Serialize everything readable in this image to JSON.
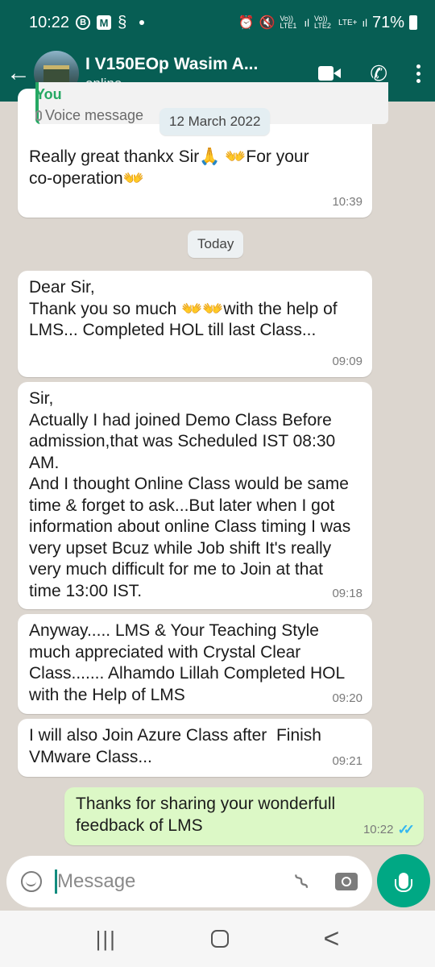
{
  "status_bar": {
    "time": "10:22",
    "icons": [
      "b-circle-icon",
      "m-square-icon",
      "swiggy-icon",
      "dot-icon"
    ],
    "network_labels": [
      "Vo)) LTE1",
      "Vo)) LTE2",
      "LTE+"
    ],
    "battery_percent": "71%"
  },
  "header": {
    "back_label": "←",
    "chat_name": "I V150EOp Wasim A...",
    "chat_status": "online",
    "actions": [
      "video-call-icon",
      "voice-call-icon",
      "more-options-icon"
    ]
  },
  "chat": {
    "date_pill": "12 March 2022",
    "today_pill": "Today",
    "quote": {
      "author": "You",
      "text": "Voice message"
    },
    "messages": [
      {
        "direction": "in",
        "text": "Really great thankx Sir🙏 👐For your co-operation👐",
        "time": "10:39"
      },
      {
        "direction": "in",
        "text": "Dear Sir,\nThank you so much 👐👐with the help of LMS... Completed HOL till last Class...",
        "time": "09:09"
      },
      {
        "direction": "in",
        "text": "Sir,\nActually I had joined Demo Class Before admission,that was Scheduled IST 08:30 AM.\nAnd I thought Online Class would be same time & forget to ask...But later when I got information about online Class timing I was very upset Bcuz while Job shift It's really very much difficult for me to Join at that time 13:00 IST.",
        "time": "09:18"
      },
      {
        "direction": "in",
        "text": "Anyway..... LMS & Your Teaching Style much appreciated with Crystal Clear Class....... Alhamdo Lillah Completed HOL with the Help of LMS",
        "time": "09:20"
      },
      {
        "direction": "in",
        "text": "I will also Join Azure Class after  Finish VMware Class...",
        "time": "09:21"
      },
      {
        "direction": "out",
        "text": "Thanks for sharing your wonderfull feedback of LMS",
        "time": "10:22",
        "ticks": "✓✓"
      }
    ]
  },
  "composer": {
    "placeholder": "Message",
    "icons": [
      "emoji-icon",
      "attach-icon",
      "camera-icon",
      "mic-icon"
    ]
  },
  "navbar": {
    "recent": "|||",
    "back": "<"
  },
  "colors": {
    "header": "#075e54",
    "accent": "#00a884",
    "outgoing": "#dcf8c6",
    "chat_bg": "#dcd6cf",
    "read_ticks": "#34b7f1"
  }
}
